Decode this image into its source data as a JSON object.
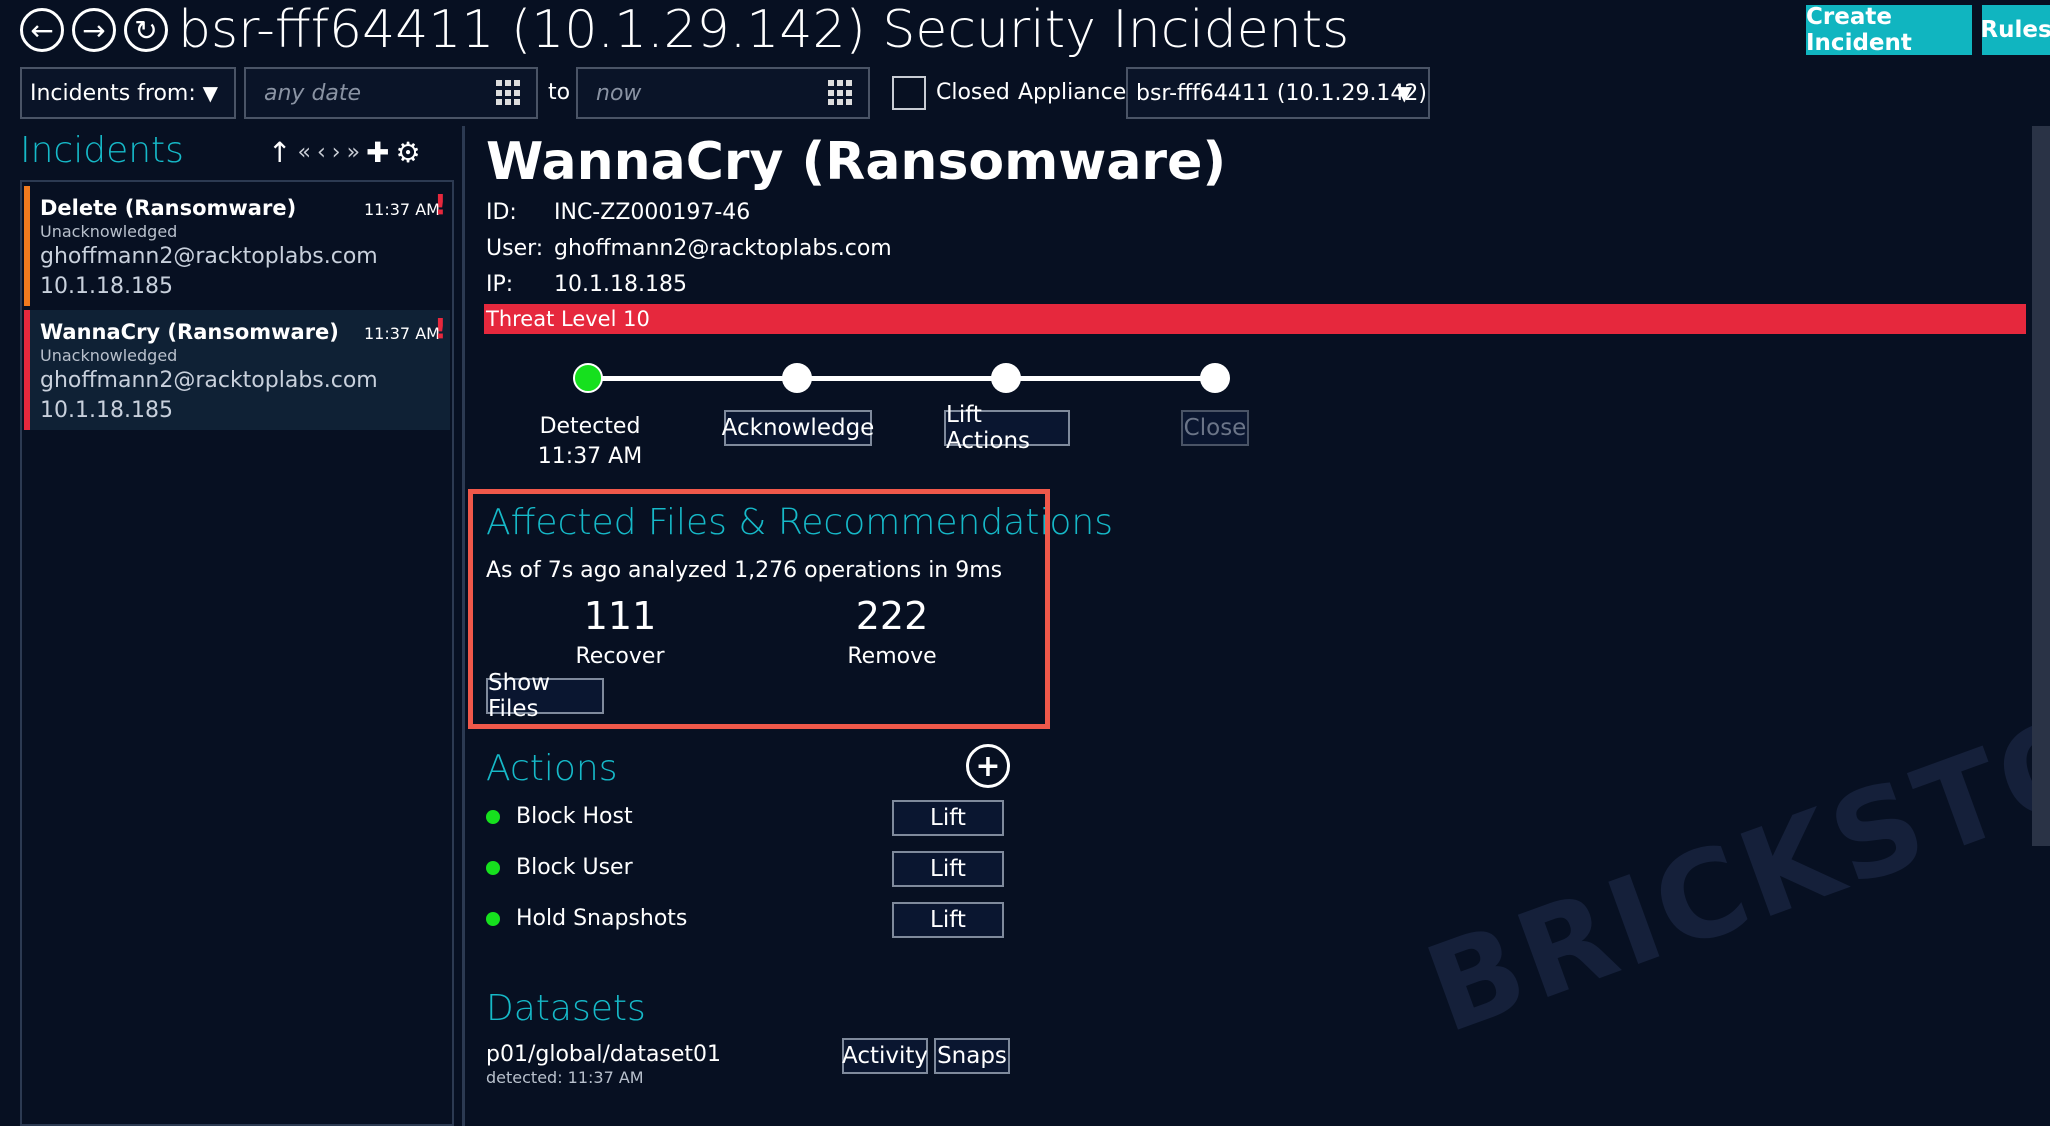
{
  "header": {
    "title": "bsr-fff64411 (10.1.29.142) Security Incidents",
    "create_incident": "Create Incident",
    "rules": "Rules"
  },
  "filters": {
    "incidents_from_label": "Incidents from:",
    "from_placeholder": "any date",
    "to_label": "to",
    "to_placeholder": "now",
    "closed_label": "Closed",
    "appliance_label": "Appliance:",
    "appliance_value": "bsr-fff64411 (10.1.29.142)"
  },
  "sidebar": {
    "heading": "Incidents",
    "items": [
      {
        "title": "Delete (Ransomware)",
        "status": "Unacknowledged",
        "user": "ghoffmann2@racktoplabs.com",
        "ip": "10.1.18.185",
        "time": "11:37 AM",
        "flag": "!",
        "accent": "#f07a1e"
      },
      {
        "title": "WannaCry (Ransomware)",
        "status": "Unacknowledged",
        "user": "ghoffmann2@racktoplabs.com",
        "ip": "10.1.18.185",
        "time": "11:37 AM",
        "flag": "!",
        "accent": "#e6283d"
      }
    ]
  },
  "detail": {
    "title": "WannaCry (Ransomware)",
    "id_label": "ID:",
    "id_value": "INC-ZZ000197-46",
    "user_label": "User:",
    "user_value": "ghoffmann2@racktoplabs.com",
    "ip_label": "IP:",
    "ip_value": "10.1.18.185",
    "threat": "Threat Level 10",
    "threat_color": "#e6283d",
    "steps": {
      "detected": "Detected",
      "detected_time": "11:37 AM",
      "acknowledge": "Acknowledge",
      "lift_actions": "Lift Actions",
      "close": "Close"
    },
    "affected": {
      "heading": "Affected Files & Recommendations",
      "summary": "As of 7s ago analyzed 1,276 operations in 9ms",
      "recover_count": "111",
      "recover_label": "Recover",
      "remove_count": "222",
      "remove_label": "Remove",
      "show_files": "Show Files"
    },
    "actions": {
      "heading": "Actions",
      "items": [
        {
          "label": "Block Host",
          "button": "Lift"
        },
        {
          "label": "Block User",
          "button": "Lift"
        },
        {
          "label": "Hold Snapshots",
          "button": "Lift"
        }
      ]
    },
    "datasets": {
      "heading": "Datasets",
      "name": "p01/global/dataset01",
      "detected": "detected: 11:37 AM",
      "activity": "Activity",
      "snaps": "Snaps"
    }
  },
  "watermark": "BRICKSTOR"
}
